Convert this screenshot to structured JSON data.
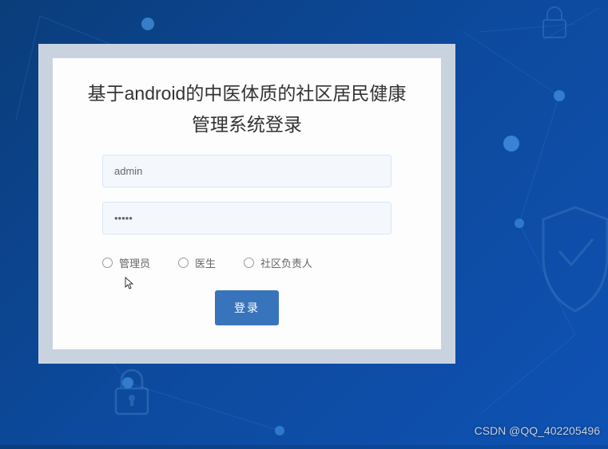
{
  "login": {
    "title": "基于android的中医体质的社区居民健康管理系统登录",
    "username_value": "admin",
    "password_value": "•••••",
    "roles": [
      {
        "label": "管理员"
      },
      {
        "label": "医生"
      },
      {
        "label": "社区负责人"
      }
    ],
    "submit_label": "登录"
  },
  "watermark": "CSDN @QQ_402205496"
}
